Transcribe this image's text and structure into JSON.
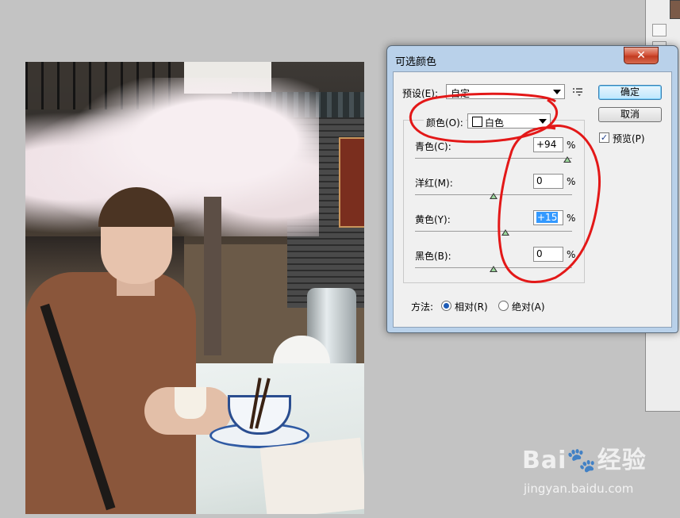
{
  "dialog": {
    "title": "可选颜色",
    "close_label": "✕",
    "preset_label": "预设(E):",
    "preset_value": "自定",
    "ok_label": "确定",
    "cancel_label": "取消",
    "preview_label": "预览(P)",
    "preview_checked": true,
    "colors_label": "颜色(O):",
    "colors_value": "白色",
    "sliders": [
      {
        "label": "青色(C):",
        "value": "+94",
        "position": 0.97
      },
      {
        "label": "洋红(M):",
        "value": "0",
        "position": 0.5
      },
      {
        "label": "黄色(Y):",
        "value": "+15",
        "position": 0.575,
        "selected": true
      },
      {
        "label": "黑色(B):",
        "value": "0",
        "position": 0.5
      }
    ],
    "percent_sign": "%",
    "method_label": "方法:",
    "method_relative": "相对(R)",
    "method_absolute": "绝对(A)",
    "method_selected": "relative"
  },
  "watermark": {
    "logo": "Bai🐾经验",
    "url": "jingyan.baidu.com"
  },
  "colors": {
    "annotation": "#e31818",
    "title_bar": "#b9d1ea",
    "close_button": "#c23b21"
  }
}
